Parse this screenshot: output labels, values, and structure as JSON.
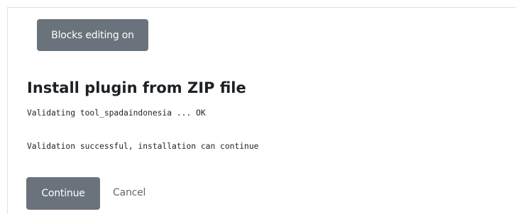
{
  "header": {
    "blocks_editing_label": "Blocks editing on"
  },
  "main": {
    "title": "Install plugin from ZIP file",
    "log_lines": [
      "Validating tool_spadaindonesia ... OK",
      "Validation successful, installation can continue"
    ]
  },
  "actions": {
    "continue_label": "Continue",
    "cancel_label": "Cancel"
  },
  "colors": {
    "secondary_button": "#6a737b",
    "link": "#5f6a74",
    "text": "#1d2125"
  }
}
